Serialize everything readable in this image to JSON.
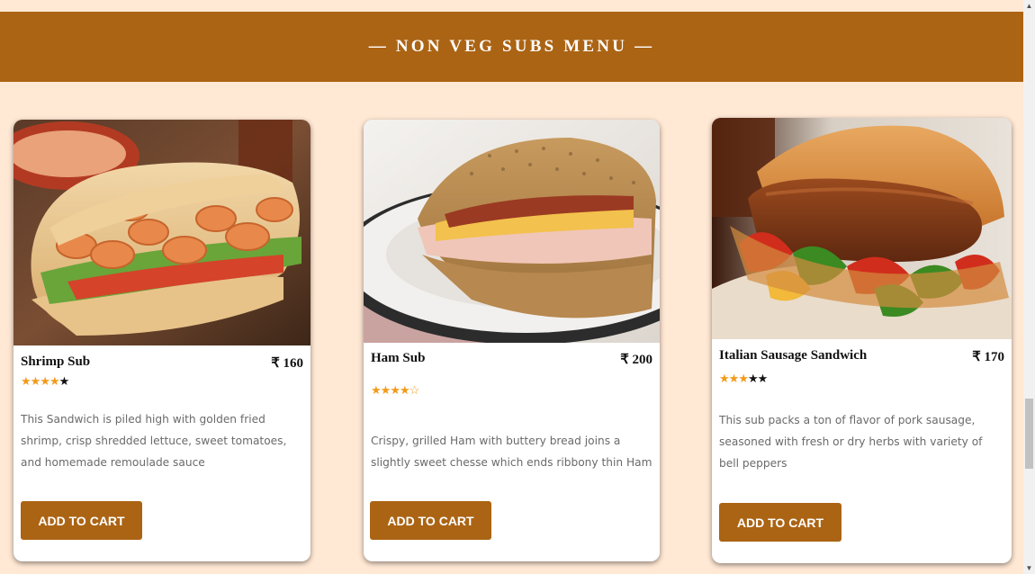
{
  "section": {
    "title": "— NON VEG SUBS MENU —"
  },
  "colors": {
    "background": "#ffe8d4",
    "accent": "#ab6414",
    "star": "#f29a1a"
  },
  "cards": [
    {
      "name": "Shrimp Sub",
      "price": "₹ 160",
      "rating": 4,
      "rating_max": 5,
      "description": "This Sandwich is piled high with golden fried shrimp, crisp shredded lettuce, sweet tomatoes, and homemade remoulade sauce",
      "button_label": "ADD TO CART",
      "image_icon": "shrimp-sub-photo"
    },
    {
      "name": "Ham Sub",
      "price": "₹ 200",
      "rating": 4.5,
      "rating_max": 5,
      "description": "Crispy, grilled Ham with buttery bread joins a slightly sweet chesse which ends ribbony thin Ham",
      "button_label": "ADD TO CART",
      "image_icon": "ham-sub-photo"
    },
    {
      "name": "Italian Sausage Sandwich",
      "price": "₹ 170",
      "rating": 2.5,
      "rating_max": 5,
      "description": "This sub packs a ton of flavor of pork sausage, seasoned with fresh or dry herbs with variety of bell peppers",
      "button_label": "ADD TO CART",
      "image_icon": "sausage-sandwich-photo"
    }
  ]
}
